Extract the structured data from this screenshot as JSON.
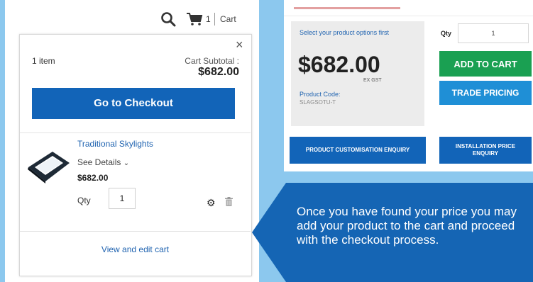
{
  "header": {
    "cart_count": "1",
    "separator": "|",
    "cart_label": "Cart"
  },
  "minicart": {
    "close": "×",
    "item_count": "1 item",
    "subtotal_label": "Cart Subtotal :",
    "subtotal_value": "$682.00",
    "checkout_label": "Go to Checkout",
    "item": {
      "name": "Traditional Skylights",
      "see_details": "See Details",
      "price": "$682.00",
      "qty_label": "Qty",
      "qty_value": "1"
    },
    "view_edit_label": "View and edit cart"
  },
  "product": {
    "select_options_text": "Select your product options first",
    "price": "$682.00",
    "ex_gst": "EX GST",
    "code_label": "Product Code:",
    "code_value": "SLAGSOTU-T",
    "qty_label": "Qty",
    "qty_value": "1",
    "add_to_cart_label": "ADD TO CART",
    "trade_pricing_label": "TRADE PRICING",
    "customisation_enquiry_label": "PRODUCT CUSTOMISATION ENQUIRY",
    "installation_enquiry_label": "INSTALLATION PRICE ENQUIRY"
  },
  "callout": {
    "text": "Once you have found your price you may add your product to the cart and proceed with the checkout process."
  },
  "colors": {
    "background": "#8cc8ee",
    "primary_blue": "#1264b8",
    "green": "#1aa052",
    "light_blue": "#1f8fd6",
    "callout": "#1565b4"
  },
  "icons": [
    "search-icon",
    "cart-icon",
    "close-icon",
    "chevron-down-icon",
    "gear-icon",
    "trash-icon"
  ]
}
